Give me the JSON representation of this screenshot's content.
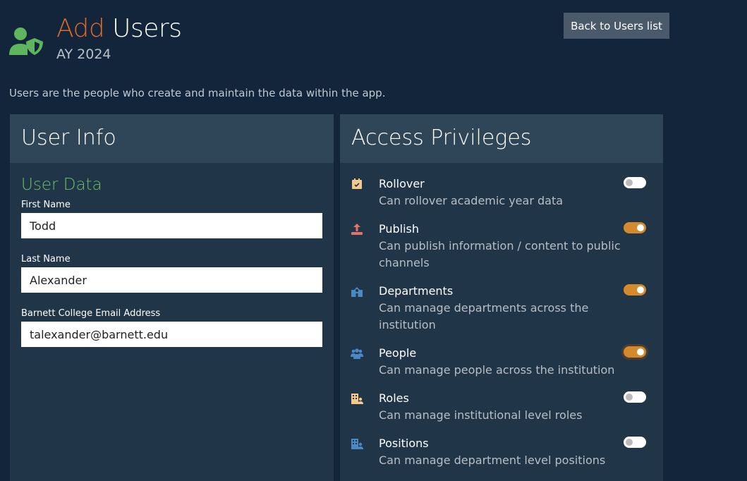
{
  "header": {
    "title_accent": "Add",
    "title_rest": "Users",
    "subtitle": "AY 2024",
    "back_button": "Back to Users list",
    "icon": "user-shield-icon",
    "accent_color": "#e0692a"
  },
  "intro": "Users are the people who create and maintain the data within the app.",
  "user_info": {
    "title": "User Info",
    "section": "User Data",
    "fields": [
      {
        "label": "First Name",
        "value": "Todd"
      },
      {
        "label": "Last Name",
        "value": "Alexander"
      },
      {
        "label": "Barnett College Email Address",
        "value": "talexander@barnett.edu"
      }
    ]
  },
  "access": {
    "title": "Access Privileges",
    "items": [
      {
        "name": "Rollover",
        "desc": "Can rollover academic year data",
        "icon": "calendar-check-icon",
        "icon_color": "#f5c98a",
        "enabled": false
      },
      {
        "name": "Publish",
        "desc": "Can publish information / content to public channels",
        "icon": "upload-icon",
        "icon_color": "#e8716a",
        "enabled": true
      },
      {
        "name": "Departments",
        "desc": "Can manage departments across the institution",
        "icon": "school-icon",
        "icon_color": "#4a8ac4",
        "enabled": true
      },
      {
        "name": "People",
        "desc": "Can manage people across the institution",
        "icon": "users-icon",
        "icon_color": "#4a8ac4",
        "enabled": true
      },
      {
        "name": "Roles",
        "desc": "Can manage institutional level roles",
        "icon": "building-user-icon",
        "icon_color": "#f5c98a",
        "enabled": false
      },
      {
        "name": "Positions",
        "desc": "Can manage department level positions",
        "icon": "building-user-icon",
        "icon_color": "#4a8ac4",
        "enabled": false
      }
    ]
  }
}
